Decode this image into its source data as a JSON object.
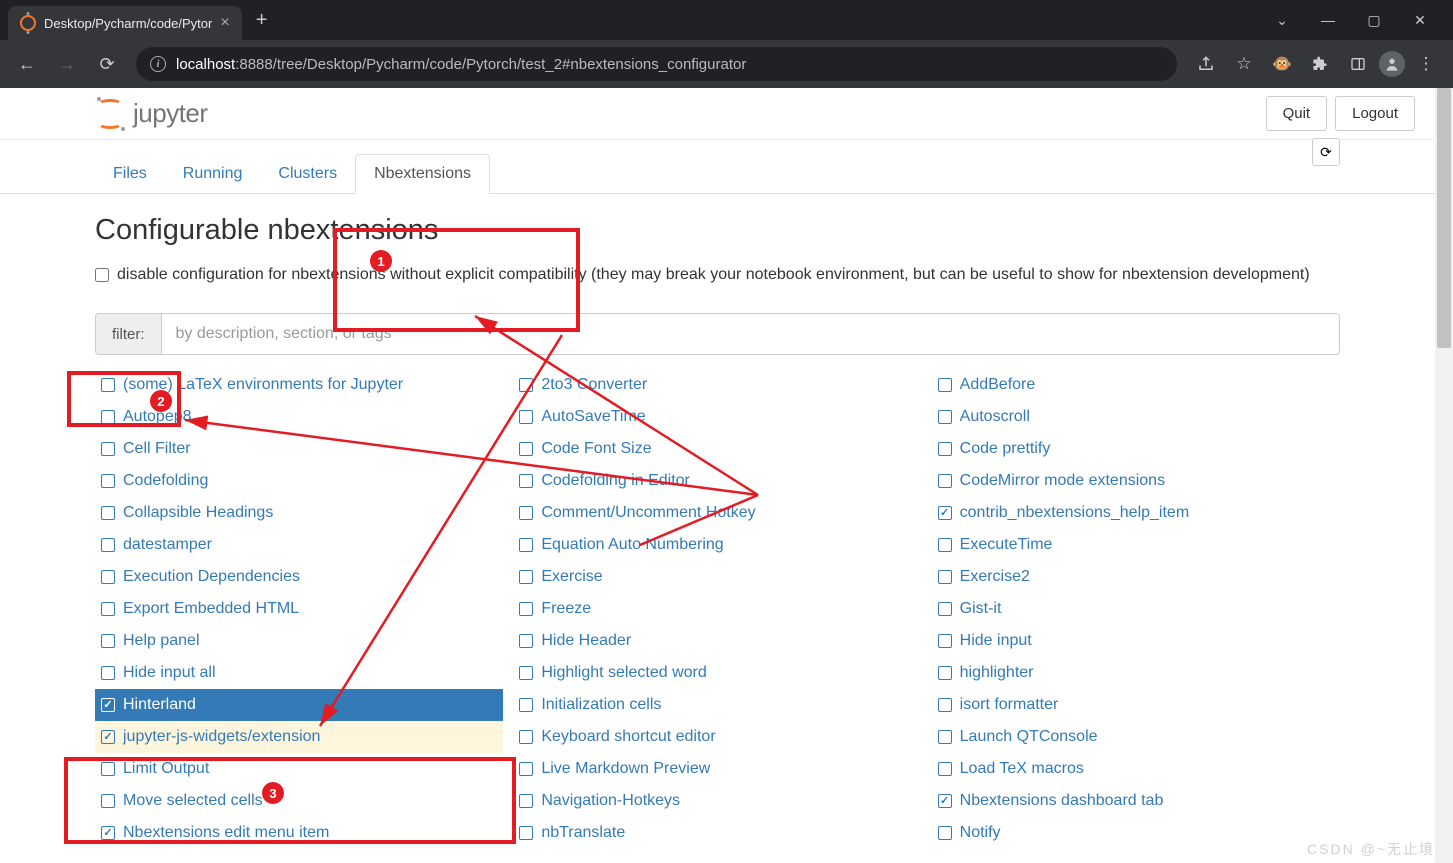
{
  "browser": {
    "tab_title": "Desktop/Pycharm/code/Pytor",
    "url_host": "localhost",
    "url_path": ":8888/tree/Desktop/Pycharm/code/Pytorch/test_2#nbextensions_configurator"
  },
  "header": {
    "logo_text": "jupyter",
    "quit": "Quit",
    "logout": "Logout"
  },
  "tabs": {
    "items": [
      "Files",
      "Running",
      "Clusters",
      "Nbextensions"
    ],
    "active_index": 3
  },
  "page": {
    "title": "Configurable nbextensions",
    "disable_label": "disable configuration for nbextensions without explicit compatibility (they may break your notebook environment, but can be useful to show for nbextension development)",
    "disable_checked": false,
    "filter_label": "filter:",
    "filter_placeholder": "by description, section, or tags"
  },
  "extensions": {
    "columns": [
      [
        {
          "label": "(some) LaTeX environments for Jupyter",
          "checked": false
        },
        {
          "label": "Autopep8",
          "checked": false
        },
        {
          "label": "Cell Filter",
          "checked": false
        },
        {
          "label": "Codefolding",
          "checked": false
        },
        {
          "label": "Collapsible Headings",
          "checked": false
        },
        {
          "label": "datestamper",
          "checked": false
        },
        {
          "label": "Execution Dependencies",
          "checked": false
        },
        {
          "label": "Export Embedded HTML",
          "checked": false
        },
        {
          "label": "Help panel",
          "checked": false
        },
        {
          "label": "Hide input all",
          "checked": false
        },
        {
          "label": "Hinterland",
          "checked": true,
          "selected": true
        },
        {
          "label": "jupyter-js-widgets/extension",
          "checked": true,
          "highlighted": true
        },
        {
          "label": "Limit Output",
          "checked": false
        },
        {
          "label": "Move selected cells",
          "checked": false
        },
        {
          "label": "Nbextensions edit menu item",
          "checked": true
        }
      ],
      [
        {
          "label": "2to3 Converter",
          "checked": false
        },
        {
          "label": "AutoSaveTime",
          "checked": false
        },
        {
          "label": "Code Font Size",
          "checked": false
        },
        {
          "label": "Codefolding in Editor",
          "checked": false
        },
        {
          "label": "Comment/Uncomment Hotkey",
          "checked": false
        },
        {
          "label": "Equation Auto Numbering",
          "checked": false
        },
        {
          "label": "Exercise",
          "checked": false
        },
        {
          "label": "Freeze",
          "checked": false
        },
        {
          "label": "Hide Header",
          "checked": false
        },
        {
          "label": "Highlight selected word",
          "checked": false
        },
        {
          "label": "Initialization cells",
          "checked": false
        },
        {
          "label": "Keyboard shortcut editor",
          "checked": false
        },
        {
          "label": "Live Markdown Preview",
          "checked": false
        },
        {
          "label": "Navigation-Hotkeys",
          "checked": false
        },
        {
          "label": "nbTranslate",
          "checked": false
        }
      ],
      [
        {
          "label": "AddBefore",
          "checked": false
        },
        {
          "label": "Autoscroll",
          "checked": false
        },
        {
          "label": "Code prettify",
          "checked": false
        },
        {
          "label": "CodeMirror mode extensions",
          "checked": false
        },
        {
          "label": "contrib_nbextensions_help_item",
          "checked": true
        },
        {
          "label": "ExecuteTime",
          "checked": false
        },
        {
          "label": "Exercise2",
          "checked": false
        },
        {
          "label": "Gist-it",
          "checked": false
        },
        {
          "label": "Hide input",
          "checked": false
        },
        {
          "label": "highlighter",
          "checked": false
        },
        {
          "label": "isort formatter",
          "checked": false
        },
        {
          "label": "Launch QTConsole",
          "checked": false
        },
        {
          "label": "Load TeX macros",
          "checked": false
        },
        {
          "label": "Nbextensions dashboard tab",
          "checked": true
        },
        {
          "label": "Notify",
          "checked": false
        }
      ]
    ]
  },
  "annotations": {
    "badge1": "1",
    "badge2": "2",
    "badge3": "3"
  },
  "watermark": "CSDN @~无止境"
}
